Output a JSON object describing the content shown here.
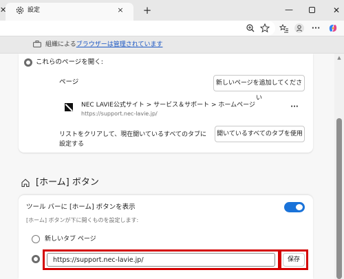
{
  "browser": {
    "tab_title": "設定",
    "tab_close": "×",
    "new_tab": "+",
    "window_min": "—",
    "window_close": "✕"
  },
  "banner": {
    "prefix": "組織による",
    "link": "ブラウザーは管理されています"
  },
  "startup": {
    "option_label": "これらのページを開く:",
    "pages_label": "ページ",
    "add_page_button": "新しいページを追加してください",
    "site_title": "NEC LAVIE公式サイト > サービス＆サポート > ホームページ",
    "site_url": "https://support.nec-lavie.jp/",
    "more_menu": "···",
    "clear_text": "リストをクリアして、現在開いているすべてのタブに設定する",
    "use_open_tabs_button": "開いているすべてのタブを使用"
  },
  "home_section": {
    "title": "[ホーム] ボタン",
    "toggle_label": "ツール バーに [ホーム] ボタンを表示",
    "description": "[ホーム] ボタンが下に開くものを設定します:",
    "toggle_on": true,
    "option_new_tab": "新しいタブ ページ",
    "url_value": "https://support.nec-lavie.jp/",
    "save_button": "保存"
  },
  "colors": {
    "accent": "#1a73d9",
    "highlight": "#d40000",
    "link": "#1a56c4"
  },
  "icons": [
    "gear-icon",
    "zoom-icon",
    "favorite-star-icon",
    "favorites-list-icon",
    "profile-icon",
    "more-icon",
    "copilot-icon",
    "briefcase-icon",
    "home-icon"
  ]
}
